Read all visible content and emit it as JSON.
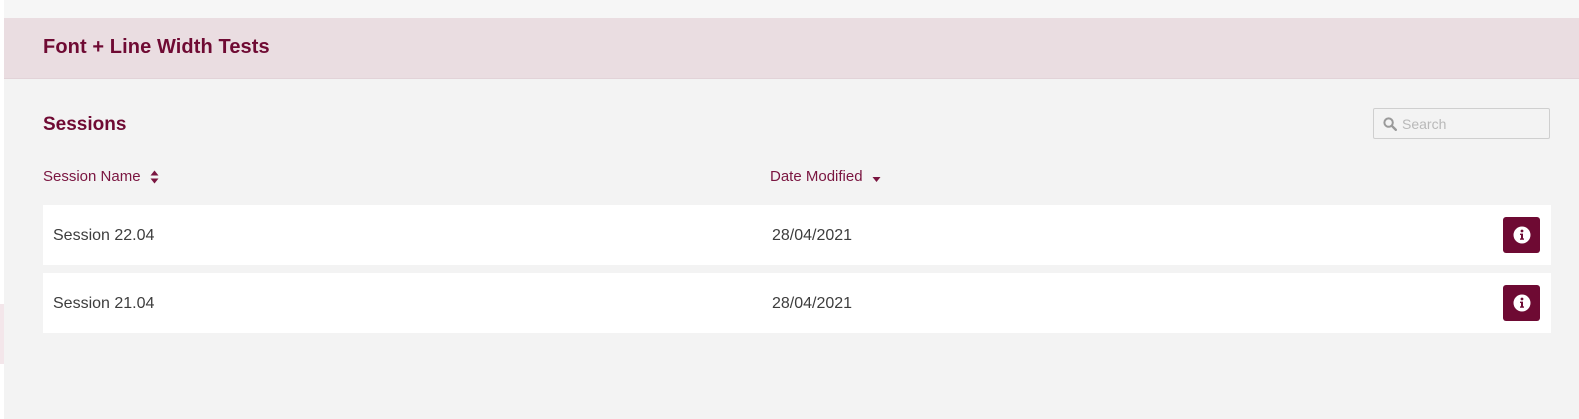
{
  "header": {
    "title": "Font + Line Width Tests"
  },
  "sessions": {
    "title": "Sessions",
    "search": {
      "placeholder": "Search",
      "value": ""
    },
    "columns": {
      "name": "Session Name",
      "date": "Date Modified"
    },
    "rows": [
      {
        "name": "Session 22.04",
        "date": "28/04/2021"
      },
      {
        "name": "Session 21.04",
        "date": "28/04/2021"
      }
    ]
  },
  "colors": {
    "brand": "#6e0a33",
    "header_bg": "#eadde1",
    "page_bg": "#f3f3f3"
  },
  "icons": {
    "search": "search-icon",
    "sort_both": "sort-both-icon",
    "sort_desc": "sort-desc-icon",
    "info": "info-icon"
  }
}
